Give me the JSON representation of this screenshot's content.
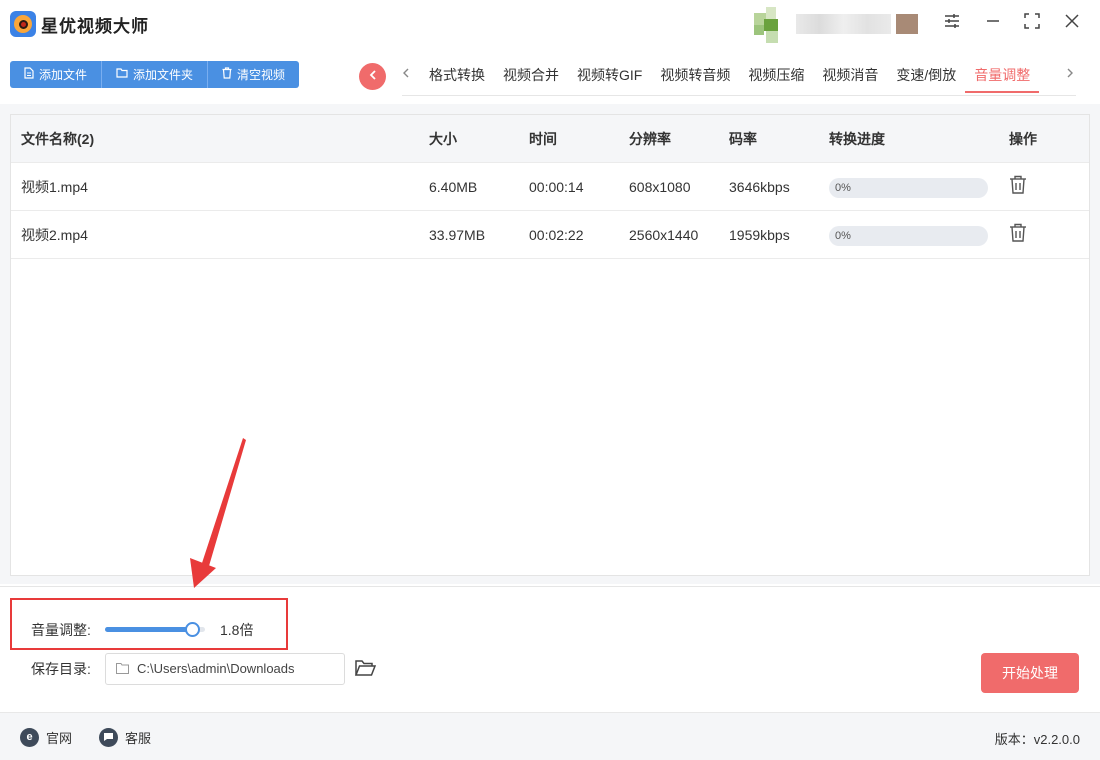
{
  "app": {
    "title": "星优视频大师"
  },
  "toolbar": {
    "add_file": "添加文件",
    "add_folder": "添加文件夹",
    "clear_videos": "清空视频"
  },
  "tabs": [
    {
      "label": "格式转换"
    },
    {
      "label": "视频合并"
    },
    {
      "label": "视频转GIF"
    },
    {
      "label": "视频转音频"
    },
    {
      "label": "视频压缩"
    },
    {
      "label": "视频消音"
    },
    {
      "label": "变速/倒放"
    },
    {
      "label": "音量调整",
      "active": true
    }
  ],
  "table": {
    "headers": {
      "name": "文件名称(2)",
      "size": "大小",
      "time": "时间",
      "resolution": "分辨率",
      "bitrate": "码率",
      "progress": "转换进度",
      "action": "操作"
    },
    "rows": [
      {
        "name": "视频1.mp4",
        "size": "6.40MB",
        "time": "00:00:14",
        "resolution": "608x1080",
        "bitrate": "3646kbps",
        "progress": "0%"
      },
      {
        "name": "视频2.mp4",
        "size": "33.97MB",
        "time": "00:02:22",
        "resolution": "2560x1440",
        "bitrate": "1959kbps",
        "progress": "0%"
      }
    ]
  },
  "settings": {
    "volume_label": "音量调整:",
    "volume_value": "1.8倍",
    "volume_fraction": 0.87,
    "save_label": "保存目录:",
    "save_path": "C:\\Users\\admin\\Downloads",
    "start_button": "开始处理"
  },
  "footer": {
    "website": "官网",
    "support": "客服",
    "version": "版本：v2.2.0.0"
  },
  "colors": {
    "accent_blue": "#4a90e2",
    "accent_red": "#f06b6b",
    "highlight_red": "#e83a3a"
  },
  "icons": [
    "app-logo-icon",
    "settings-icon",
    "minimize-icon",
    "maximize-icon",
    "close-icon",
    "file-icon",
    "folder-icon",
    "trash-icon",
    "chevron-left-icon",
    "chevron-right-icon",
    "open-folder-icon",
    "website-icon",
    "chat-icon"
  ]
}
